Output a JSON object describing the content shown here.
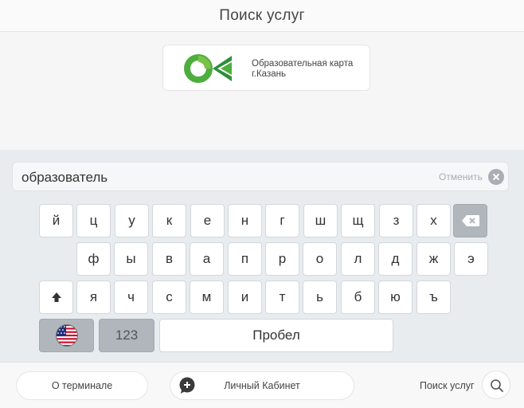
{
  "header": {
    "title": "Поиск услуг"
  },
  "card": {
    "logo_icon": "ok-logo",
    "line1": "Образовательная карта",
    "line2": "г.Казань"
  },
  "search": {
    "value": "образователь",
    "cancel_label": "Отменить",
    "clear_icon": "clear-icon"
  },
  "keyboard": {
    "row1": [
      "й",
      "ц",
      "у",
      "к",
      "е",
      "н",
      "г",
      "ш",
      "щ",
      "з",
      "х"
    ],
    "row2": [
      "ф",
      "ы",
      "в",
      "а",
      "п",
      "р",
      "о",
      "л",
      "д",
      "ж",
      "э"
    ],
    "row3": [
      "я",
      "ч",
      "с",
      "м",
      "и",
      "т",
      "ь",
      "б",
      "ю",
      "ъ"
    ],
    "backspace_icon": "backspace-icon",
    "shift_icon": "shift-up-arrow-icon",
    "language_icon": "us-flag-icon",
    "numbers_label": "123",
    "space_label": "Пробел"
  },
  "footer": {
    "terminal_label": "О терминале",
    "cabinet_label": "Личный Кабинет",
    "search_label": "Поиск услуг",
    "search_icon": "search-icon"
  },
  "colors": {
    "logo_green": "#4cae3d",
    "logo_dark_green": "#2e8f3b",
    "keyboard_bg": "#e9ecef",
    "dark_key": "#b0b6bc"
  }
}
